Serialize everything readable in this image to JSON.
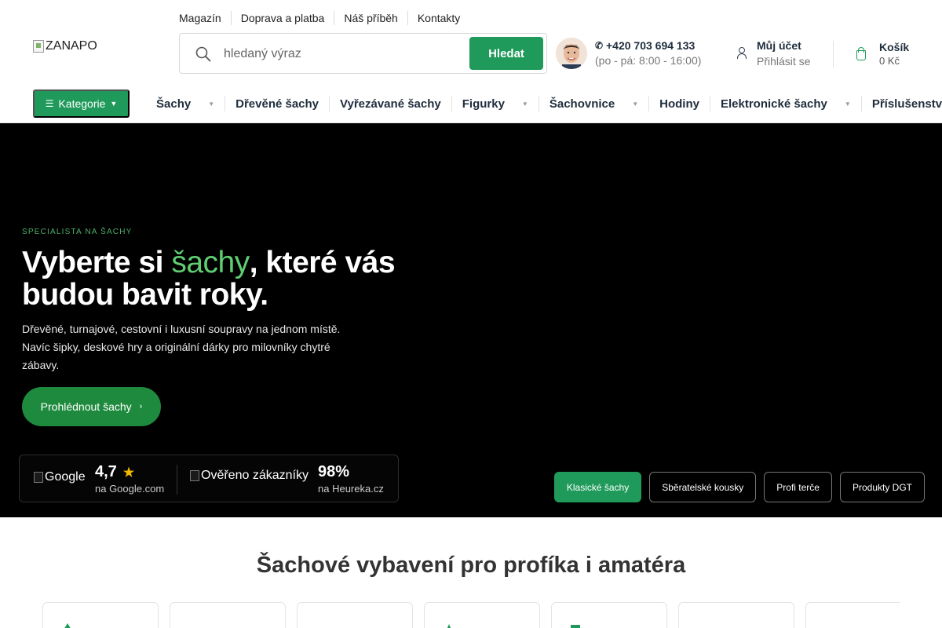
{
  "top_links": [
    "Magazín",
    "Doprava a platba",
    "Náš příběh",
    "Kontakty"
  ],
  "logo": {
    "alt": "ZANAPO"
  },
  "search": {
    "placeholder": "hledaný výraz",
    "button_label": "Hledat"
  },
  "contact": {
    "phone": "+420 703 694 133",
    "hours": "(po - pá: 8:00 - 16:00)"
  },
  "account": {
    "title": "Můj účet",
    "subtitle": "Přihlásit se"
  },
  "cart": {
    "title": "Košík",
    "total": "0 Kč"
  },
  "category_button": "Kategorie",
  "nav": [
    {
      "label": "Šachy",
      "has_dropdown": true
    },
    {
      "label": "Dřevěné šachy",
      "has_dropdown": false
    },
    {
      "label": "Vyřezávané šachy",
      "has_dropdown": false
    },
    {
      "label": "Figurky",
      "has_dropdown": true
    },
    {
      "label": "Šachovnice",
      "has_dropdown": true
    },
    {
      "label": "Hodiny",
      "has_dropdown": false
    },
    {
      "label": "Elektronické šachy",
      "has_dropdown": true
    },
    {
      "label": "Příslušenství",
      "has_dropdown": false
    }
  ],
  "hero": {
    "eyebrow": "SPECIALISTA NA ŠACHY",
    "headline_part1": "Vyberte si ",
    "headline_accent": "šachy",
    "headline_part2": ", které vás budou bavit roky.",
    "subtext": "Dřevěné, turnajové, cestovní i luxusní soupravy na jednom místě. Navíc šipky, deskové hry a originální dárky pro milovníky chytré zábavy.",
    "cta_label": "Prohlédnout šachy",
    "accent_color": "#5fce73",
    "background_color": "#000000"
  },
  "ratings": {
    "google": {
      "logo_alt": "Google",
      "value": "4,7",
      "source": "na Google.com"
    },
    "heureka": {
      "logo_alt": "Ověřeno zákazníky",
      "value": "98%",
      "source": "na Heureka.cz"
    }
  },
  "chips": [
    {
      "label": "Klasické šachy",
      "active": true
    },
    {
      "label": "Sběratelské kousky",
      "active": false
    },
    {
      "label": "Profi terče",
      "active": false
    },
    {
      "label": "Produkty DGT",
      "active": false
    }
  ],
  "section": {
    "title": "Šachové vybavení pro profíka i amatéra"
  },
  "colors": {
    "brand_green": "#1f9a5a",
    "cta_green": "#1e8a3e",
    "star": "#f5b800"
  }
}
